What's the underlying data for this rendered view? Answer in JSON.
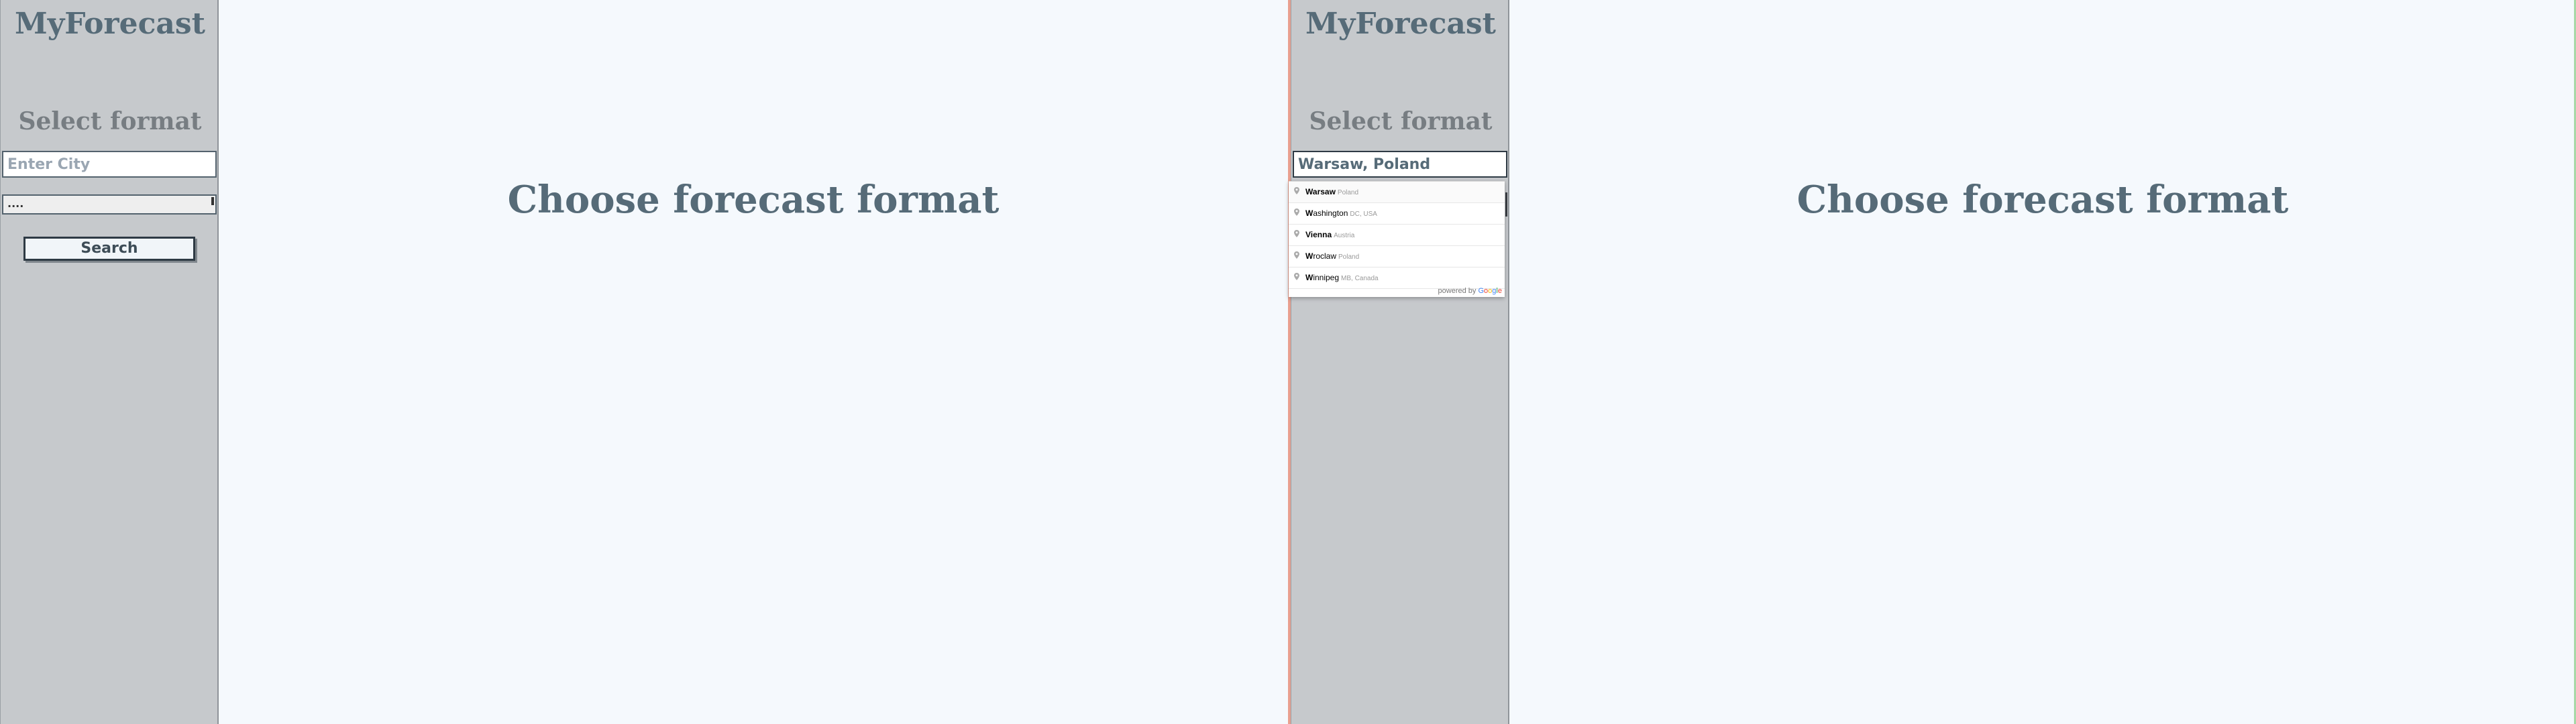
{
  "app": {
    "title": "MyForecast"
  },
  "sidebar": {
    "format_title": "Select format",
    "city_placeholder": "Enter City",
    "select_value": "....",
    "search_label": "Search"
  },
  "main": {
    "heading": "Choose forecast format"
  },
  "right_pane": {
    "city_value": "Warsaw, Poland",
    "autocomplete": {
      "items": [
        {
          "match": "W",
          "rest": "arsaw",
          "sub": "Poland"
        },
        {
          "match": "W",
          "rest": "ashington",
          "sub": "DC, USA"
        },
        {
          "match": "Vienna",
          "rest": "",
          "sub": "Austria"
        },
        {
          "match": "W",
          "rest": "roclaw",
          "sub": "Poland"
        },
        {
          "match": "W",
          "rest": "innipeg",
          "sub": "MB, Canada"
        }
      ],
      "footer_prefix": "powered by ",
      "footer_brand": [
        "G",
        "o",
        "o",
        "g",
        "l",
        "e"
      ]
    }
  },
  "colors": {
    "sidebar_bg": "#c6c9cc",
    "page_bg": "#f5f9fd",
    "title_text": "#566b78"
  }
}
